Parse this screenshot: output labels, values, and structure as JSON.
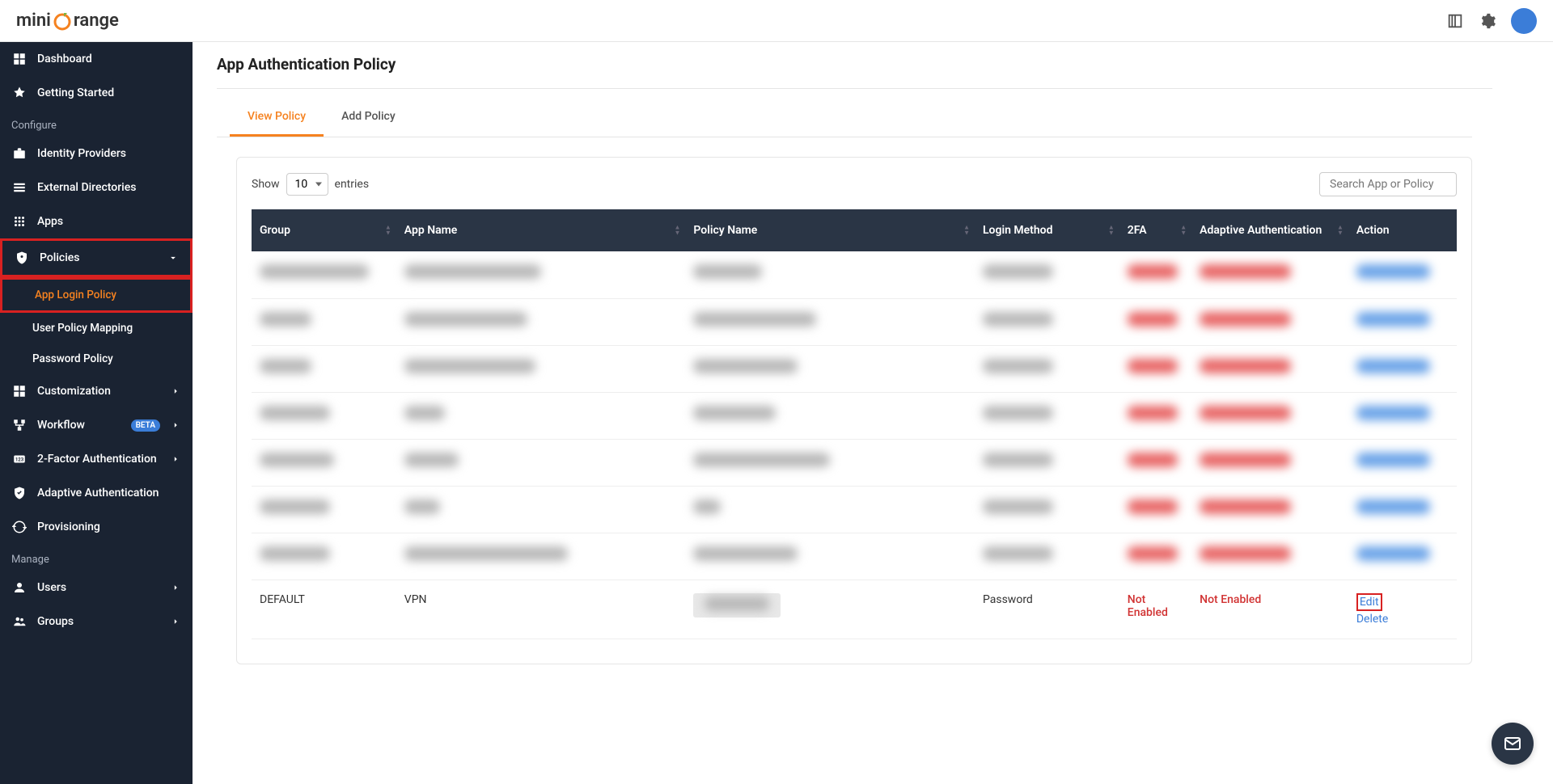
{
  "logo": {
    "part1": "mini",
    "part2": "range"
  },
  "sidebar": {
    "dashboard": "Dashboard",
    "getting_started": "Getting Started",
    "section_configure": "Configure",
    "identity_providers": "Identity Providers",
    "external_directories": "External Directories",
    "apps": "Apps",
    "policies": "Policies",
    "app_login_policy": "App Login Policy",
    "user_policy_mapping": "User Policy Mapping",
    "password_policy": "Password Policy",
    "customization": "Customization",
    "workflow": "Workflow",
    "workflow_badge": "BETA",
    "two_factor": "2-Factor Authentication",
    "adaptive_auth": "Adaptive Authentication",
    "provisioning": "Provisioning",
    "section_manage": "Manage",
    "users": "Users",
    "groups": "Groups"
  },
  "page": {
    "title": "App Authentication Policy"
  },
  "tabs": {
    "view_policy": "View Policy",
    "add_policy": "Add Policy"
  },
  "table_controls": {
    "show": "Show",
    "entries": "entries",
    "entries_value": "10",
    "search_placeholder": "Search App or Policy"
  },
  "columns": {
    "group": "Group",
    "app_name": "App Name",
    "policy_name": "Policy Name",
    "login_method": "Login Method",
    "two_fa": "2FA",
    "adaptive_auth": "Adaptive Authentication",
    "action": "Action"
  },
  "visible_row": {
    "group": "DEFAULT",
    "app_name": "VPN",
    "policy_name": "",
    "login_method": "Password",
    "two_fa": "Not Enabled",
    "adaptive_auth": "Not Enabled",
    "edit": "Edit",
    "delete": "Delete"
  }
}
